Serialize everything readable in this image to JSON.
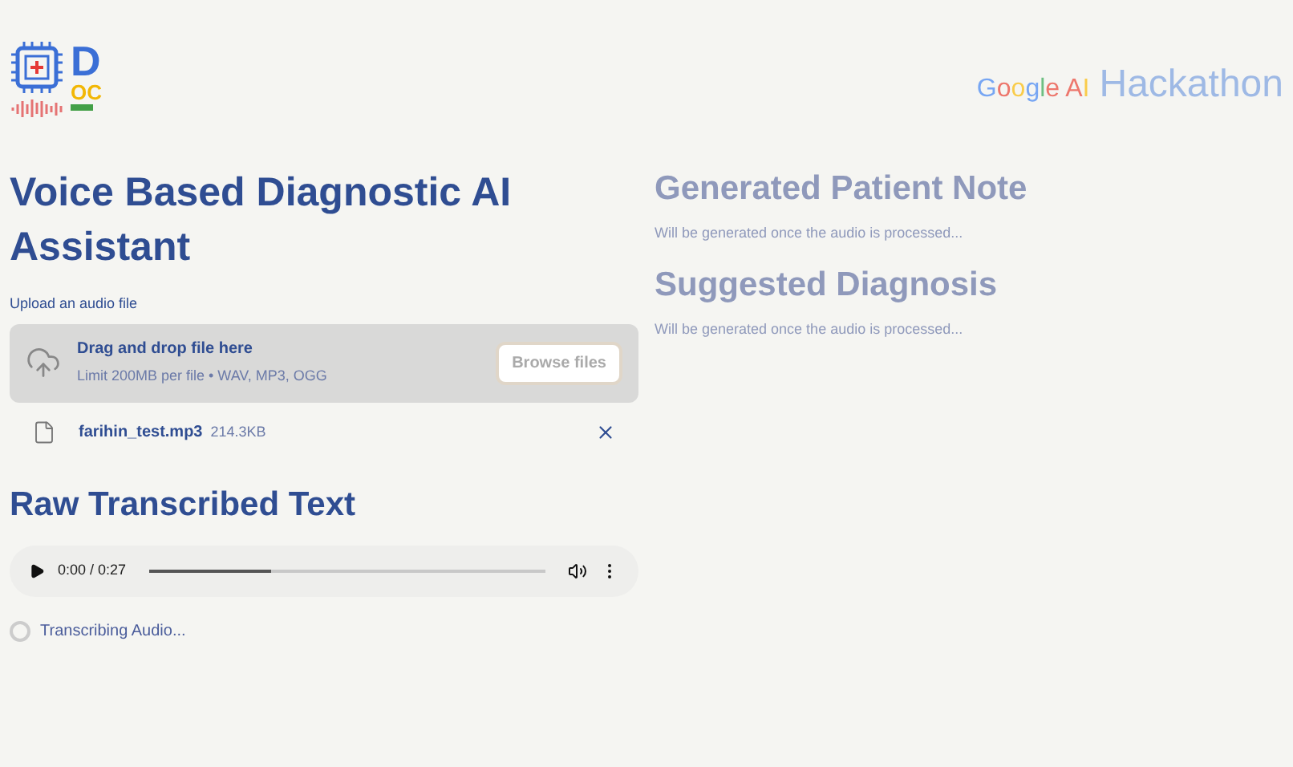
{
  "logo": {
    "letter_top": "D",
    "letters_bottom": "OC"
  },
  "sponsor": {
    "brand": "Google AI",
    "event": "Hackathon"
  },
  "title": "Voice Based Diagnostic AI Assistant",
  "uploader": {
    "label": "Upload an audio file",
    "dropzone_title": "Drag and drop file here",
    "dropzone_hint": "Limit 200MB per file • WAV, MP3, OGG",
    "button": "Browse files"
  },
  "file": {
    "name": "farihin_test.mp3",
    "size": "214.3KB"
  },
  "transcript": {
    "heading": "Raw Transcribed Text",
    "player": {
      "time": "0:00 / 0:27",
      "level": 0.31
    },
    "status": "Transcribing Audio..."
  },
  "sections": [
    {
      "heading": "Generated Patient Note",
      "text": "Will be generated once the audio is processed..."
    },
    {
      "heading": "Suggested Diagnosis",
      "text": "Will be generated once the audio is processed..."
    }
  ]
}
